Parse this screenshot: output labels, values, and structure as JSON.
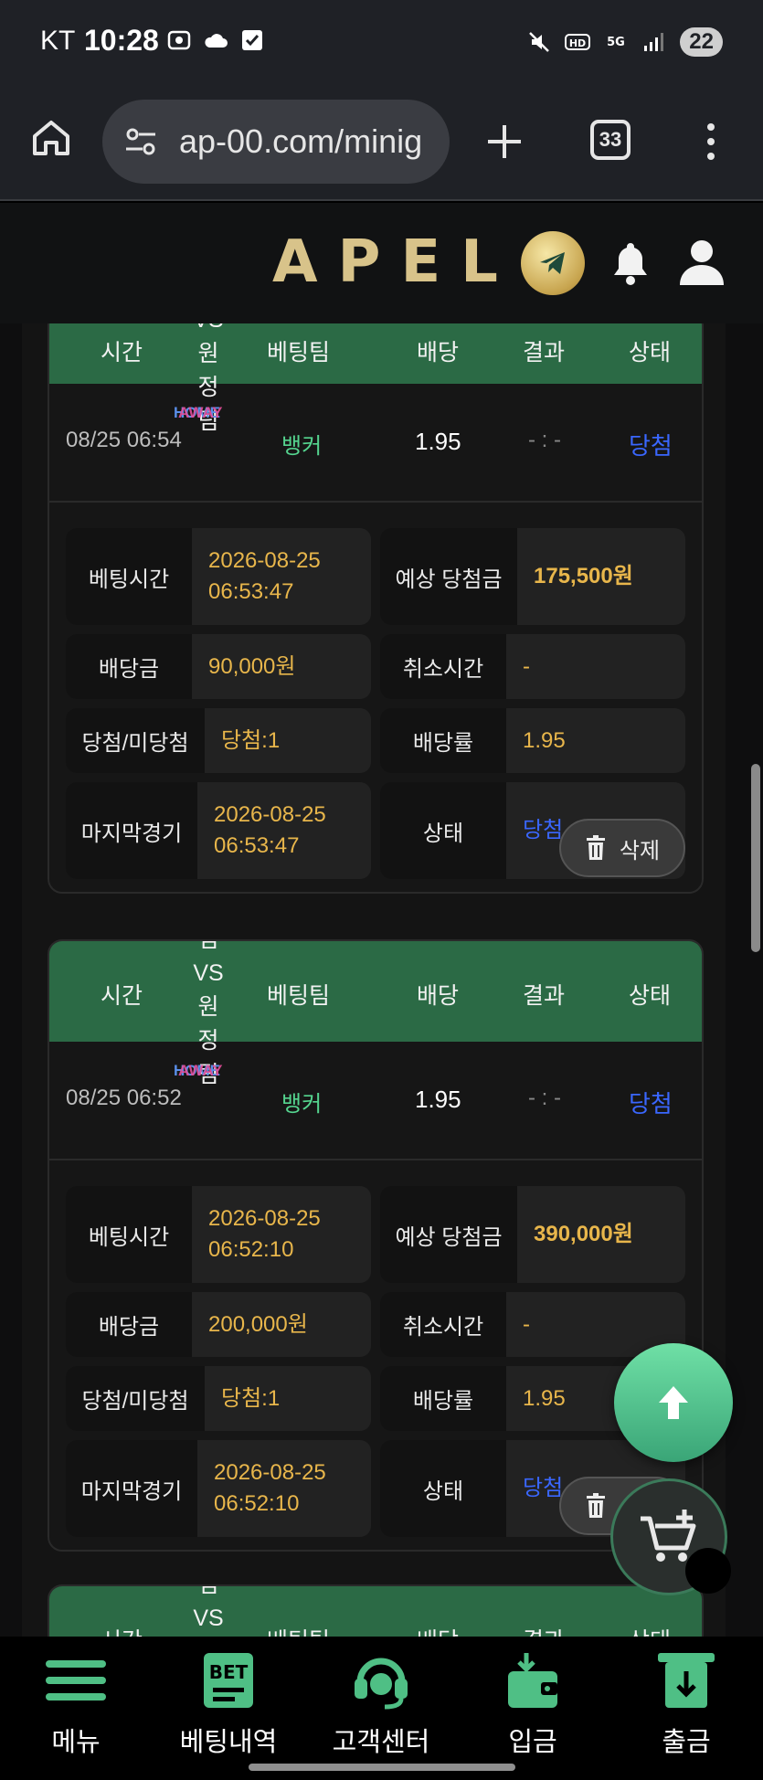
{
  "status_bar": {
    "carrier": "KT",
    "time": "10:28",
    "battery": "22"
  },
  "browser": {
    "url": "ap-00.com/minig",
    "tab_count": "33"
  },
  "site": {
    "logo": "APEL"
  },
  "table_headers": {
    "time": "시간",
    "vs": [
      "VS",
      "원",
      "정",
      "팀"
    ],
    "vs_top_partial": "팀",
    "team": "베팅팀",
    "odds": "배당",
    "result": "결과",
    "status": "상태",
    "home": "HOME",
    "away": "AWAY"
  },
  "bets": [
    {
      "time": "08/25 06:54",
      "team": "뱅커",
      "odds": "1.95",
      "result": "- : -",
      "status": "당첨",
      "details": {
        "bet_time_label": "베팅시간",
        "bet_time_value": "2026-08-25\n06:53:47",
        "expected_label": "예상 당첨금",
        "expected_value": "175,500원",
        "amount_label": "배당금",
        "amount_value": "90,000원",
        "cancel_label": "취소시간",
        "cancel_value": "-",
        "winlose_label": "당첨/미당첨",
        "winlose_value": "당첨:1",
        "rate_label": "배당률",
        "rate_value": "1.95",
        "last_label": "마지막경기",
        "last_value": "2026-08-25\n06:53:47",
        "state_label": "상태",
        "state_value": "당첨",
        "delete_label": "삭제"
      }
    },
    {
      "time": "08/25 06:52",
      "team": "뱅커",
      "odds": "1.95",
      "result": "- : -",
      "status": "당첨",
      "details": {
        "bet_time_label": "베팅시간",
        "bet_time_value": "2026-08-25\n06:52:10",
        "expected_label": "예상 당첨금",
        "expected_value": "390,000원",
        "amount_label": "배당금",
        "amount_value": "200,000원",
        "cancel_label": "취소시간",
        "cancel_value": "-",
        "winlose_label": "당첨/미당첨",
        "winlose_value": "당첨:1",
        "rate_label": "배당률",
        "rate_value": "1.95",
        "last_label": "마지막경기",
        "last_value": "2026-08-25\n06:52:10",
        "state_label": "상태",
        "state_value": "당첨",
        "delete_label": "삭제"
      }
    }
  ],
  "bottom_nav": {
    "menu": "메뉴",
    "bet_history": "베팅내역",
    "bet_badge": "BET",
    "support": "고객센터",
    "deposit": "입금",
    "withdraw": "출금"
  },
  "colors": {
    "header_green": "#2b6a45",
    "accent_gold": "#e8b64b",
    "status_blue": "#3a67ff",
    "team_green": "#55d58f"
  }
}
